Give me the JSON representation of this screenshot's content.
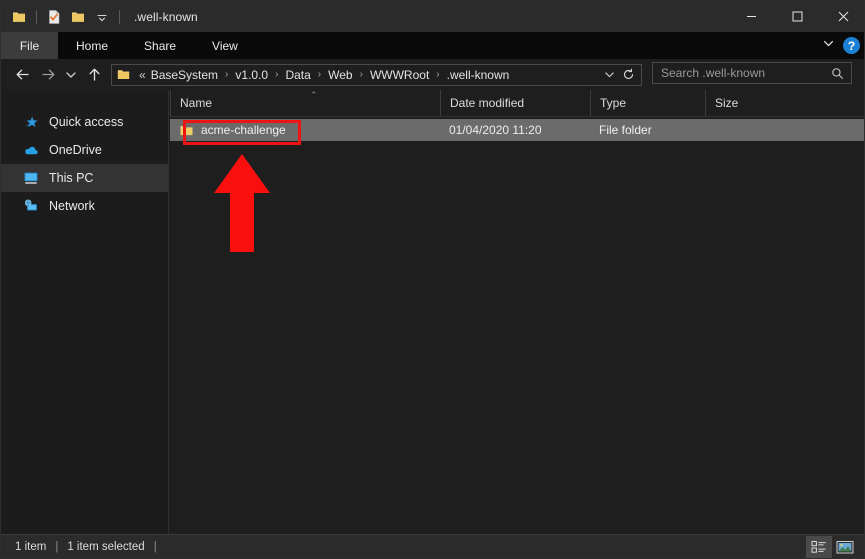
{
  "window": {
    "title": ".well-known",
    "quick_access_toolbar": [
      {
        "name": "folder-icon",
        "label": "Explorer"
      },
      {
        "name": "properties-icon",
        "label": "Properties"
      },
      {
        "name": "new-folder-icon",
        "label": "New folder"
      },
      {
        "name": "chevron-down-icon",
        "label": "Customize Quick Access Toolbar"
      }
    ],
    "controls": {
      "minimize": "—",
      "maximize": "☐",
      "close": "✕"
    }
  },
  "ribbon": {
    "tabs": [
      {
        "label": "File",
        "selected": true
      },
      {
        "label": "Home",
        "selected": false
      },
      {
        "label": "Share",
        "selected": false
      },
      {
        "label": "View",
        "selected": false
      }
    ],
    "collapse_icon": "chevron-down-icon",
    "help_label": "?"
  },
  "navigation": {
    "back_icon": "arrow-left-icon",
    "forward_icon": "arrow-right-icon",
    "recent_icon": "chevron-down-icon",
    "up_icon": "arrow-up-icon",
    "breadcrumb": {
      "leading": "«",
      "separator": "›",
      "items": [
        "BaseSystem",
        "v1.0.0",
        "Data",
        "Web",
        "WWWRoot",
        ".well-known"
      ]
    },
    "history_icon": "chevron-down-icon",
    "refresh_icon": "refresh-icon"
  },
  "search": {
    "placeholder": "Search .well-known",
    "icon": "search-icon"
  },
  "sidebar": {
    "items": [
      {
        "label": "Quick access",
        "icon": "star-icon",
        "selected": false
      },
      {
        "label": "OneDrive",
        "icon": "cloud-icon",
        "selected": false
      },
      {
        "label": "This PC",
        "icon": "monitor-icon",
        "selected": true
      },
      {
        "label": "Network",
        "icon": "network-icon",
        "selected": false
      }
    ]
  },
  "file_list": {
    "columns": [
      {
        "label": "Name",
        "sorted": "ascending"
      },
      {
        "label": "Date modified",
        "sorted": ""
      },
      {
        "label": "Type",
        "sorted": ""
      },
      {
        "label": "Size",
        "sorted": ""
      }
    ],
    "sort_caret": "⌃",
    "rows": [
      {
        "name": "acme-challenge",
        "date_modified": "01/04/2020 11:20",
        "type": "File folder",
        "size": "",
        "icon": "folder-icon",
        "selected": true,
        "annotated": true
      }
    ]
  },
  "status_bar": {
    "item_count": "1 item",
    "selection": "1 item selected",
    "separator": "|",
    "view_buttons": [
      {
        "name": "details-view-icon",
        "active": true
      },
      {
        "name": "large-icons-view-icon",
        "active": false
      }
    ]
  },
  "annotations": {
    "highlight_color": "#ef1414",
    "rectangle": {
      "target": "acme-challenge"
    },
    "arrow": {
      "direction": "up",
      "target": "acme-challenge"
    }
  }
}
